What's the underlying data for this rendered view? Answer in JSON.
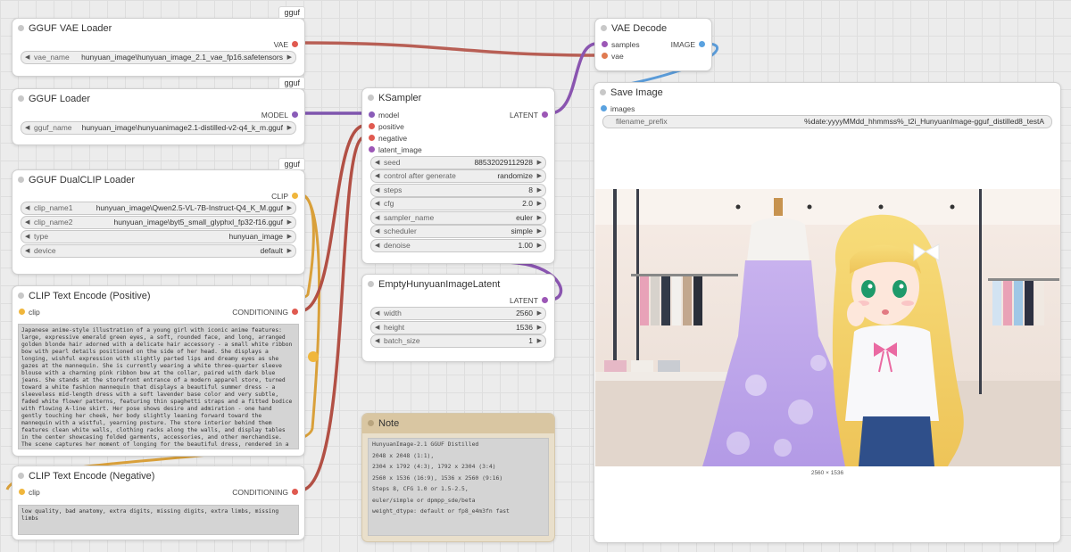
{
  "badge_label": "gguf",
  "nodes": {
    "vae_loader": {
      "title": "GGUF VAE Loader",
      "output": "VAE",
      "widgets": [
        {
          "name": "vae_name",
          "value": "hunyuan_image\\hunyuan_image_2.1_vae_fp16.safetensors"
        }
      ]
    },
    "gguf_loader": {
      "title": "GGUF Loader",
      "output": "MODEL",
      "widgets": [
        {
          "name": "gguf_name",
          "value": "hunyuan_image\\hunyuanimage2.1-distilled-v2-q4_k_m.gguf"
        }
      ]
    },
    "dualclip": {
      "title": "GGUF DualCLIP Loader",
      "output": "CLIP",
      "widgets": [
        {
          "name": "clip_name1",
          "value": "hunyuan_image\\Qwen2.5-VL-7B-Instruct-Q4_K_M.gguf"
        },
        {
          "name": "clip_name2",
          "value": "hunyuan_image\\byt5_small_glyphxl_fp32-f16.gguf"
        },
        {
          "name": "type",
          "value": "hunyuan_image"
        },
        {
          "name": "device",
          "value": "default"
        }
      ]
    },
    "clip_pos": {
      "title": "CLIP Text Encode (Positive)",
      "input": "clip",
      "output": "CONDITIONING",
      "text": "Japanese anime-style illustration of a young girl with iconic anime features: large, expressive emerald green eyes, a soft, rounded face, and long, arranged golden blonde hair adorned with a delicate hair accessory - a small white ribbon bow with pearl details positioned on the side of her head. She displays a longing, wishful expression with slightly parted lips and dreamy eyes as she gazes at the mannequin. She is currently wearing a white three-quarter sleeve blouse with a charming pink ribbon bow at the collar, paired with dark blue jeans. She stands at the storefront entrance of a modern apparel store, turned toward a white fashion mannequin that displays a beautiful summer dress - a sleeveless mid-length dress with a soft lavender base color and very subtle, faded white flower patterns, featuring thin spaghetti straps and a fitted bodice with flowing A-line skirt. Her pose shows desire and admiration - one hand gently touching her cheek, her body slightly leaning forward toward the mannequin with a wistful, yearning posture. The store interior behind them features clean white walls, clothing racks along the walls, and display tables in the center showcasing folded garments, accessories, and other merchandise. The scene captures her moment of longing for the beautiful dress, rendered in a detailed and vibrant anime art style with warm, inviting lighting."
    },
    "clip_neg": {
      "title": "CLIP Text Encode (Negative)",
      "input": "clip",
      "output": "CONDITIONING",
      "text": "low quality, bad anatomy, extra digits, missing digits, extra limbs, missing limbs"
    },
    "ksampler": {
      "title": "KSampler",
      "inputs": [
        "model",
        "positive",
        "negative",
        "latent_image"
      ],
      "output": "LATENT",
      "widgets": [
        {
          "name": "seed",
          "value": "88532029112928"
        },
        {
          "name": "control after generate",
          "value": "randomize"
        },
        {
          "name": "steps",
          "value": "8"
        },
        {
          "name": "cfg",
          "value": "2.0"
        },
        {
          "name": "sampler_name",
          "value": "euler"
        },
        {
          "name": "scheduler",
          "value": "simple"
        },
        {
          "name": "denoise",
          "value": "1.00"
        }
      ]
    },
    "empty_latent": {
      "title": "EmptyHunyuanImageLatent",
      "output": "LATENT",
      "widgets": [
        {
          "name": "width",
          "value": "2560"
        },
        {
          "name": "height",
          "value": "1536"
        },
        {
          "name": "batch_size",
          "value": "1"
        }
      ]
    },
    "note": {
      "title": "Note",
      "lines": [
        "HunyuanImage-2.1 GGUF Distilled",
        "2048 x 2048 (1:1),",
        "2304 x 1792 (4:3),  1792 x 2304 (3:4)",
        "2560 x 1536 (16:9), 1536 x 2560 (9:16)",
        "Steps 8, CFG 1.0 or 1.5-2.5,",
        "euler/simple or dpmpp_sde/beta",
        "weight_dtype: default or fp8_e4m3fn fast"
      ]
    },
    "vae_decode": {
      "title": "VAE Decode",
      "inputs": [
        "samples",
        "vae"
      ],
      "output": "IMAGE"
    },
    "save_image": {
      "title": "Save Image",
      "input": "images",
      "widgets": [
        {
          "name": "filename_prefix",
          "value": "%date:yyyyMMdd_hhmmss%_t2i_HunyuanImage-gguf_distilled8_testA"
        }
      ],
      "preview_caption": "2560 × 1536"
    }
  },
  "colors": {
    "canvas_bg": "#ececec",
    "vae_slot": "#e05a50",
    "model_slot": "#8a5cb8",
    "clip_slot": "#f0b63c",
    "conditioning_slot": "#e05a50",
    "latent_slot": "#9c57b6",
    "image_slot": "#5aa2e0",
    "note_bg": "#e9dfcb",
    "note_header": "#d9c6a2"
  },
  "icons": [
    "left-arrow-icon",
    "right-arrow-icon",
    "node-status-dot"
  ]
}
